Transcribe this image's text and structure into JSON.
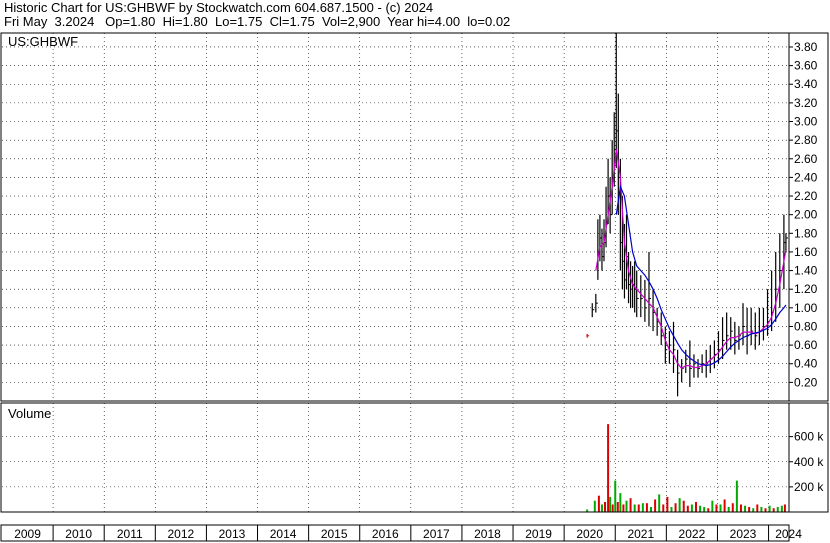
{
  "header": {
    "line1": "Historic Chart for US:GHBWF by Stockwatch.com 604.687.1500 - (c) 2024",
    "line2": "Fri May  3.2024   Op=1.80  Hi=1.80  Lo=1.75  Cl=1.75  Vol=2,900  Year hi=4.00  lo=0.02"
  },
  "colors": {
    "price_bar": "#000000",
    "ma_short": "#cc00cc",
    "ma_long": "#0000cc",
    "early_price": "#cc0000",
    "volume_up": "#00aa00",
    "volume_down": "#dd0000",
    "grid": "#000000"
  },
  "chart_data": [
    {
      "type": "line",
      "title": "US:GHBWF",
      "ylim": [
        0,
        3.95
      ],
      "yticks": [
        "0.20",
        "0.40",
        "0.60",
        "0.80",
        "1.00",
        "1.20",
        "1.40",
        "1.60",
        "1.80",
        "2.00",
        "2.20",
        "2.40",
        "2.60",
        "2.80",
        "3.00",
        "3.20",
        "3.40",
        "3.60",
        "3.80"
      ],
      "ytick_values": [
        0.2,
        0.4,
        0.6,
        0.8,
        1.0,
        1.2,
        1.4,
        1.6,
        1.8,
        2.0,
        2.2,
        2.4,
        2.6,
        2.8,
        3.0,
        3.2,
        3.4,
        3.6,
        3.8
      ],
      "xlim": [
        2009.0,
        2024.4
      ],
      "xticks": [
        "2009",
        "2010",
        "2011",
        "2012",
        "2013",
        "2014",
        "2015",
        "2016",
        "2017",
        "2018",
        "2019",
        "2020",
        "2021",
        "2022",
        "2023",
        "2024"
      ],
      "xtick_values": [
        2009,
        2010,
        2011,
        2012,
        2013,
        2014,
        2015,
        2016,
        2017,
        2018,
        2019,
        2020,
        2021,
        2022,
        2023,
        2024
      ],
      "grid": true,
      "series": [
        {
          "name": "",
          "kind": "price",
          "x": [
            2020.45,
            2020.55,
            2020.62,
            2020.66,
            2020.7,
            2020.74,
            2020.78,
            2020.82,
            2020.86,
            2020.9,
            2020.94,
            2020.98,
            2021.02,
            2021.06,
            2021.1,
            2021.14,
            2021.18,
            2021.22,
            2021.26,
            2021.3,
            2021.34,
            2021.38,
            2021.42,
            2021.5,
            2021.58,
            2021.66,
            2021.74,
            2021.82,
            2021.9,
            2021.98,
            2022.06,
            2022.14,
            2022.22,
            2022.3,
            2022.38,
            2022.46,
            2022.54,
            2022.62,
            2022.7,
            2022.78,
            2022.86,
            2022.94,
            2023.02,
            2023.1,
            2023.18,
            2023.26,
            2023.34,
            2023.42,
            2023.5,
            2023.58,
            2023.66,
            2023.74,
            2023.82,
            2023.9,
            2023.98,
            2024.06,
            2024.14,
            2024.22,
            2024.3,
            2024.34
          ],
          "high": [
            0.72,
            1.05,
            1.15,
            1.95,
            2.0,
            1.85,
            1.95,
            2.3,
            2.6,
            2.4,
            2.8,
            3.1,
            3.95,
            3.3,
            2.6,
            2.2,
            1.9,
            2.0,
            1.6,
            1.5,
            1.45,
            1.5,
            1.4,
            1.35,
            1.3,
            1.6,
            1.2,
            1.0,
            0.95,
            0.8,
            0.75,
            0.85,
            0.55,
            0.45,
            0.55,
            0.65,
            0.5,
            0.45,
            0.5,
            0.55,
            0.6,
            0.65,
            0.75,
            0.9,
            0.95,
            0.9,
            0.85,
            0.8,
            1.05,
            1.0,
            1.0,
            0.95,
            1.0,
            1.0,
            1.2,
            1.4,
            1.6,
            1.8,
            2.0,
            1.8
          ],
          "low": [
            0.68,
            0.9,
            0.95,
            1.3,
            1.5,
            1.4,
            1.5,
            1.65,
            1.9,
            1.8,
            2.0,
            2.3,
            2.5,
            2.0,
            1.4,
            1.2,
            1.1,
            1.2,
            1.05,
            1.0,
            1.0,
            0.95,
            0.9,
            0.9,
            0.85,
            0.8,
            0.75,
            0.7,
            0.6,
            0.4,
            0.4,
            0.3,
            0.05,
            0.2,
            0.3,
            0.15,
            0.25,
            0.25,
            0.3,
            0.25,
            0.3,
            0.35,
            0.4,
            0.45,
            0.55,
            0.55,
            0.5,
            0.55,
            0.6,
            0.5,
            0.6,
            0.55,
            0.6,
            0.65,
            0.7,
            0.75,
            0.85,
            1.0,
            1.2,
            1.6
          ],
          "close": [
            0.7,
            0.98,
            1.05,
            1.6,
            1.75,
            1.55,
            1.7,
            1.9,
            2.2,
            2.0,
            2.4,
            2.7,
            2.9,
            2.4,
            1.7,
            1.5,
            1.3,
            1.55,
            1.25,
            1.2,
            1.25,
            1.2,
            1.1,
            1.1,
            1.0,
            1.1,
            0.95,
            0.85,
            0.7,
            0.55,
            0.6,
            0.55,
            0.3,
            0.35,
            0.45,
            0.35,
            0.4,
            0.35,
            0.4,
            0.4,
            0.45,
            0.5,
            0.55,
            0.65,
            0.7,
            0.75,
            0.65,
            0.7,
            0.8,
            0.7,
            0.75,
            0.7,
            0.75,
            0.8,
            0.85,
            0.95,
            1.2,
            1.4,
            1.7,
            1.75
          ]
        },
        {
          "name": "",
          "kind": "ma_short",
          "x": [
            2020.62,
            2020.7,
            2020.78,
            2020.86,
            2020.94,
            2021.02,
            2021.1,
            2021.18,
            2021.26,
            2021.34,
            2021.42,
            2021.5,
            2021.58,
            2021.66,
            2021.74,
            2021.82,
            2021.9,
            2021.98,
            2022.06,
            2022.14,
            2022.22,
            2022.3,
            2022.38,
            2022.46,
            2022.54,
            2022.62,
            2022.7,
            2022.78,
            2022.86,
            2022.94,
            2023.02,
            2023.1,
            2023.18,
            2023.26,
            2023.34,
            2023.42,
            2023.5,
            2023.58,
            2023.66,
            2023.74,
            2023.82,
            2023.9,
            2023.98,
            2024.06,
            2024.14,
            2024.22,
            2024.3,
            2024.34
          ],
          "y": [
            1.4,
            1.65,
            1.7,
            2.0,
            2.3,
            2.7,
            2.4,
            1.7,
            1.4,
            1.25,
            1.2,
            1.15,
            1.1,
            1.05,
            1.0,
            0.9,
            0.8,
            0.65,
            0.55,
            0.5,
            0.4,
            0.35,
            0.38,
            0.38,
            0.36,
            0.36,
            0.38,
            0.4,
            0.44,
            0.48,
            0.52,
            0.58,
            0.64,
            0.68,
            0.68,
            0.7,
            0.74,
            0.74,
            0.74,
            0.72,
            0.74,
            0.78,
            0.82,
            0.9,
            1.05,
            1.25,
            1.5,
            1.62
          ]
        },
        {
          "name": "",
          "kind": "ma_long",
          "x": [
            2021.02,
            2021.1,
            2021.18,
            2021.26,
            2021.34,
            2021.42,
            2021.5,
            2021.58,
            2021.66,
            2021.74,
            2021.82,
            2021.9,
            2021.98,
            2022.06,
            2022.14,
            2022.22,
            2022.3,
            2022.38,
            2022.46,
            2022.54,
            2022.62,
            2022.7,
            2022.78,
            2022.86,
            2022.94,
            2023.02,
            2023.1,
            2023.18,
            2023.26,
            2023.34,
            2023.42,
            2023.5,
            2023.58,
            2023.66,
            2023.74,
            2023.82,
            2023.9,
            2023.98,
            2024.06,
            2024.14,
            2024.22,
            2024.3,
            2024.34
          ],
          "y": [
            2.0,
            2.3,
            2.2,
            1.9,
            1.6,
            1.45,
            1.4,
            1.35,
            1.28,
            1.2,
            1.1,
            0.98,
            0.88,
            0.78,
            0.7,
            0.62,
            0.55,
            0.5,
            0.46,
            0.43,
            0.4,
            0.39,
            0.38,
            0.39,
            0.41,
            0.44,
            0.48,
            0.53,
            0.58,
            0.62,
            0.65,
            0.68,
            0.7,
            0.72,
            0.73,
            0.74,
            0.76,
            0.78,
            0.82,
            0.88,
            0.95,
            1.0,
            1.03
          ]
        }
      ]
    },
    {
      "type": "bar",
      "title": "Volume",
      "ylim": [
        0,
        820000
      ],
      "yticks": [
        "200 k",
        "400 k",
        "600 k"
      ],
      "ytick_values": [
        200000,
        400000,
        600000
      ],
      "x": [
        2020.45,
        2020.6,
        2020.68,
        2020.74,
        2020.8,
        2020.86,
        2020.9,
        2020.95,
        2021.0,
        2021.05,
        2021.1,
        2021.16,
        2021.22,
        2021.3,
        2021.38,
        2021.46,
        2021.54,
        2021.62,
        2021.7,
        2021.78,
        2021.86,
        2021.94,
        2022.02,
        2022.1,
        2022.18,
        2022.26,
        2022.34,
        2022.42,
        2022.5,
        2022.58,
        2022.66,
        2022.74,
        2022.82,
        2022.9,
        2022.98,
        2023.06,
        2023.14,
        2023.22,
        2023.3,
        2023.38,
        2023.46,
        2023.54,
        2023.62,
        2023.7,
        2023.78,
        2023.86,
        2023.94,
        2024.02,
        2024.1,
        2024.18,
        2024.26,
        2024.32
      ],
      "values": [
        20000,
        90000,
        130000,
        60000,
        80000,
        700000,
        120000,
        60000,
        250000,
        80000,
        150000,
        60000,
        90000,
        110000,
        60000,
        60000,
        70000,
        70000,
        40000,
        100000,
        140000,
        60000,
        120000,
        40000,
        70000,
        110000,
        90000,
        50000,
        60000,
        80000,
        50000,
        40000,
        30000,
        90000,
        60000,
        60000,
        100000,
        40000,
        70000,
        250000,
        60000,
        50000,
        40000,
        30000,
        60000,
        40000,
        30000,
        50000,
        30000,
        40000,
        50000,
        60000
      ],
      "up": [
        true,
        true,
        false,
        true,
        false,
        false,
        true,
        false,
        true,
        false,
        true,
        false,
        true,
        false,
        true,
        false,
        true,
        false,
        true,
        false,
        true,
        false,
        false,
        true,
        false,
        true,
        false,
        false,
        true,
        false,
        true,
        true,
        false,
        true,
        false,
        true,
        false,
        true,
        false,
        true,
        false,
        true,
        false,
        true,
        false,
        true,
        false,
        true,
        false,
        true,
        true,
        false
      ]
    }
  ],
  "price_panel": {
    "label": "US:GHBWF"
  },
  "volume_panel": {
    "label": "Volume"
  }
}
